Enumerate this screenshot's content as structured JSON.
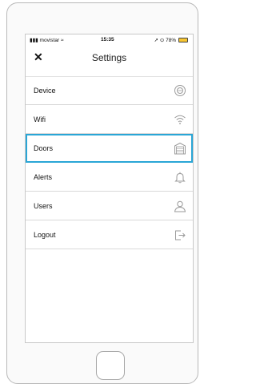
{
  "status_bar": {
    "carrier": "movistar",
    "time": "15:35",
    "battery": "78%"
  },
  "header": {
    "close_label": "✕",
    "title": "Settings"
  },
  "settings": {
    "items": [
      {
        "label": "Device",
        "icon": "device-icon"
      },
      {
        "label": "Wifi",
        "icon": "wifi-icon"
      },
      {
        "label": "Doors",
        "icon": "garage-door-icon",
        "selected": true
      },
      {
        "label": "Alerts",
        "icon": "bell-icon"
      },
      {
        "label": "Users",
        "icon": "user-icon"
      },
      {
        "label": "Logout",
        "icon": "logout-icon"
      }
    ]
  },
  "colors": {
    "selection_border": "#2aa6d6",
    "battery": "#f7c531",
    "icon_gray": "#9a9a9a"
  }
}
